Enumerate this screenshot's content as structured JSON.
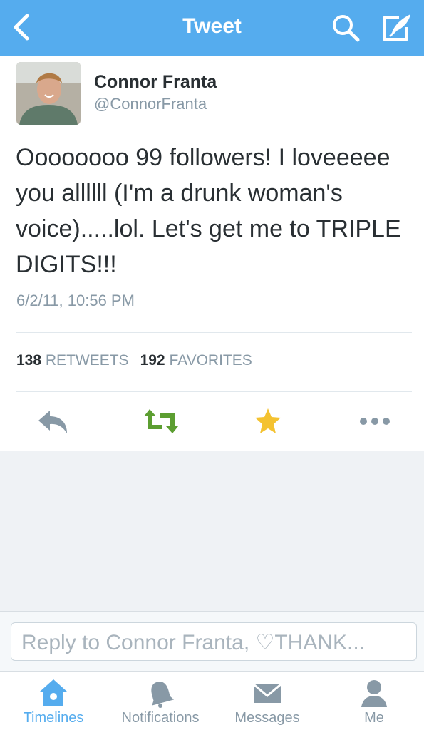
{
  "header": {
    "title": "Tweet"
  },
  "tweet": {
    "author_name": "Connor Franta",
    "author_handle": "@ConnorFranta",
    "text": "Oooooooo 99 followers! I loveeeee you allllll (I'm a drunk woman's voice).....lol. Let's get me to TRIPLE DIGITS!!!",
    "timestamp": "6/2/11, 10:56 PM"
  },
  "stats": {
    "retweets_count": "138",
    "retweets_label": "RETWEETS",
    "favorites_count": "192",
    "favorites_label": "FAVORITES"
  },
  "actions": [
    "reply-icon",
    "retweet-icon",
    "favorite-star-icon",
    "more-icon"
  ],
  "reply": {
    "placeholder": "Reply to Connor Franta, ♡THANK..."
  },
  "tabs": [
    {
      "label": "Timelines",
      "icon": "home-icon",
      "active": true
    },
    {
      "label": "Notifications",
      "icon": "bell-icon",
      "active": false
    },
    {
      "label": "Messages",
      "icon": "envelope-icon",
      "active": false
    },
    {
      "label": "Me",
      "icon": "person-icon",
      "active": false
    }
  ],
  "colors": {
    "brand": "#55acee",
    "retweet": "#5c9e31",
    "favorite": "#f4c230",
    "muted": "#8899a6"
  }
}
